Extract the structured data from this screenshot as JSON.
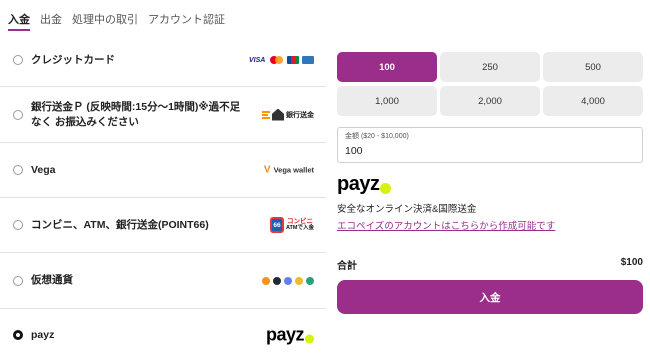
{
  "tabs": [
    {
      "label": "入金",
      "active": true
    },
    {
      "label": "出金",
      "active": false
    },
    {
      "label": "処理中の取引",
      "active": false
    },
    {
      "label": "アカウント認証",
      "active": false
    }
  ],
  "methods": [
    {
      "label": "クレジットカード",
      "selected": false,
      "logo": {
        "visa": "VISA"
      }
    },
    {
      "label": "銀行送金Ｐ (反映時間:15分〜1時間)※過不足なく お振込みください",
      "selected": false,
      "logo": {
        "text": "銀行送金"
      }
    },
    {
      "label": "Vega",
      "selected": false,
      "logo": {
        "text": "Vega wallet"
      }
    },
    {
      "label": "コンビニ、ATM、銀行送金(POINT66)",
      "selected": false,
      "logo": {
        "badge": "66",
        "line1": "コンビニ",
        "line2": "ATMで入金"
      }
    },
    {
      "label": "仮想通貨",
      "selected": false,
      "logo": {}
    },
    {
      "label": "payz",
      "selected": true,
      "logo": {
        "text": "payz"
      }
    }
  ],
  "amounts": [
    "100",
    "250",
    "500",
    "1,000",
    "2,000",
    "4,000"
  ],
  "selected_amount": "100",
  "amount_field": {
    "label": "金額 ($20 - $10,000)",
    "value": "100"
  },
  "payz": {
    "logo": "payz",
    "description": "安全なオンライン決済&国際送金",
    "link": "エコペイズのアカウントはこちらから作成可能です"
  },
  "total": {
    "label": "合計",
    "value": "$100"
  },
  "submit_label": "入金",
  "colors": {
    "accent": "#9b2e8a",
    "payz_dot": "#d7f20f"
  }
}
